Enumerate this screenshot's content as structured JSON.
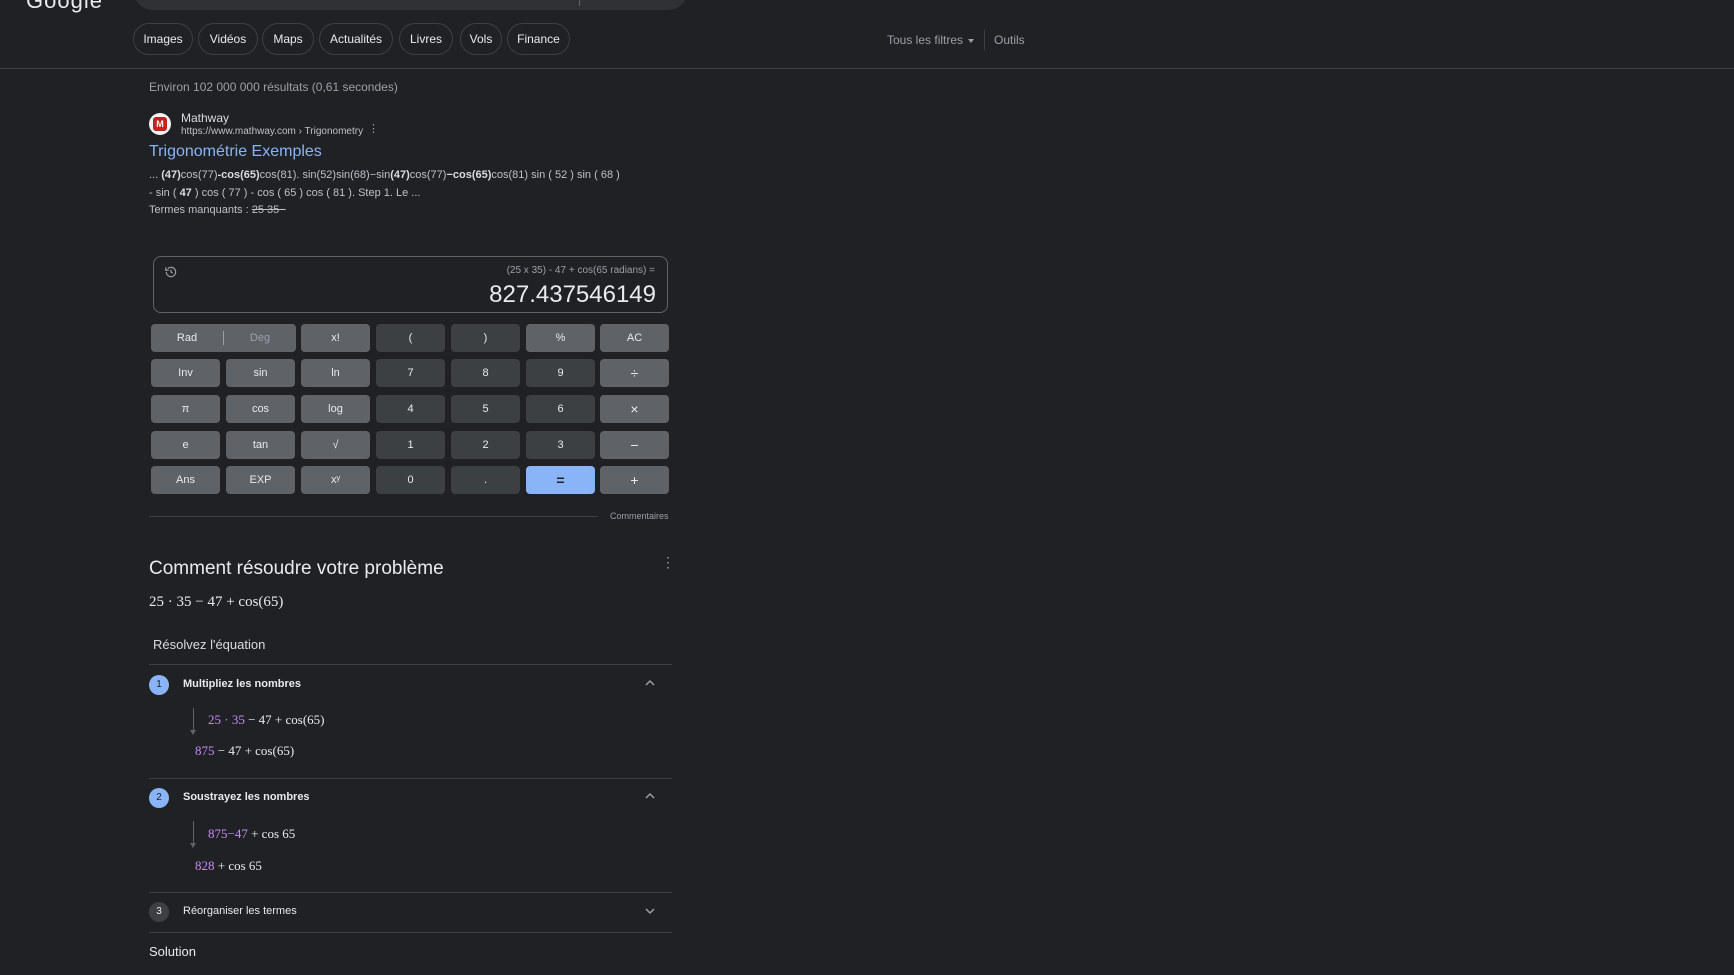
{
  "header": {
    "logo": "Google",
    "tabs": [
      "Images",
      "Vidéos",
      "Maps",
      "Actualités",
      "Livres",
      "Vols",
      "Finance"
    ],
    "filters_label": "Tous les filtres",
    "tools_label": "Outils"
  },
  "result_stats": "Environ 102 000 000 résultats (0,61 secondes)",
  "result": {
    "favicon_letter": "M",
    "site_name": "Mathway",
    "url": "https://www.mathway.com › Trigonometry",
    "title": "Trigonométrie Exemples",
    "snippet_1": [
      {
        "t": "... ",
        "b": false
      },
      {
        "t": "(47)",
        "b": true
      },
      {
        "t": "cos(77)",
        "b": false
      },
      {
        "t": "-cos(65)",
        "b": true
      },
      {
        "t": "cos(81). sin(52)sin(68)−sin",
        "b": false
      },
      {
        "t": "(47)",
        "b": true
      },
      {
        "t": "cos(77)",
        "b": false
      },
      {
        "t": "−cos(65)",
        "b": true
      },
      {
        "t": "cos(81) sin ( 52 ) sin ( 68 )",
        "b": false
      }
    ],
    "snippet_2": [
      {
        "t": "- sin ( ",
        "b": false
      },
      {
        "t": "47",
        "b": true
      },
      {
        "t": " ) cos ( 77 ) - cos ( 65 ) cos ( 81 ). Step 1. Le ...",
        "b": false
      }
    ],
    "missing_label": "Termes manquants : ",
    "missing_terms": "25 35−"
  },
  "calculator": {
    "expression": "(25 x 35) - 47 + cos(65 radians) =",
    "result": "827.437546149",
    "rad_label": "Rad",
    "deg_label": "Deg",
    "feedback_label": "Commentaires",
    "keys": [
      {
        "label": "x!",
        "kind": "func"
      },
      {
        "label": "(",
        "kind": "num"
      },
      {
        "label": ")",
        "kind": "num"
      },
      {
        "label": "%",
        "kind": "func"
      },
      {
        "label": "AC",
        "kind": "func"
      },
      {
        "label": "Inv",
        "kind": "func"
      },
      {
        "label": "sin",
        "kind": "func"
      },
      {
        "label": "ln",
        "kind": "func"
      },
      {
        "label": "7",
        "kind": "num"
      },
      {
        "label": "8",
        "kind": "num"
      },
      {
        "label": "9",
        "kind": "num"
      },
      {
        "label": "÷",
        "kind": "op"
      },
      {
        "label": "π",
        "kind": "func"
      },
      {
        "label": "cos",
        "kind": "func"
      },
      {
        "label": "log",
        "kind": "func"
      },
      {
        "label": "4",
        "kind": "num"
      },
      {
        "label": "5",
        "kind": "num"
      },
      {
        "label": "6",
        "kind": "num"
      },
      {
        "label": "×",
        "kind": "op"
      },
      {
        "label": "e",
        "kind": "func"
      },
      {
        "label": "tan",
        "kind": "func"
      },
      {
        "label": "√",
        "kind": "func"
      },
      {
        "label": "1",
        "kind": "num"
      },
      {
        "label": "2",
        "kind": "num"
      },
      {
        "label": "3",
        "kind": "num"
      },
      {
        "label": "−",
        "kind": "op"
      },
      {
        "label": "Ans",
        "kind": "func"
      },
      {
        "label": "EXP",
        "kind": "func"
      },
      {
        "label": "xʸ",
        "kind": "func"
      },
      {
        "label": "0",
        "kind": "num"
      },
      {
        "label": ".",
        "kind": "num"
      },
      {
        "label": "=",
        "kind": "eq"
      },
      {
        "label": "+",
        "kind": "op"
      }
    ]
  },
  "solver": {
    "title": "Comment résoudre votre problème",
    "expression": "25 · 35 − 47 + cos(65)",
    "subtitle": "Résolvez l'équation",
    "solution_label": "Solution",
    "steps": [
      {
        "number": "1",
        "title": "Multipliez les nombres",
        "expanded": true,
        "from": [
          {
            "t": "25 · 35",
            "hl": true
          },
          {
            "t": " − 47 + cos(65)",
            "hl": false
          }
        ],
        "to": [
          {
            "t": "875",
            "hl": true
          },
          {
            "t": " − 47 + cos(65)",
            "hl": false
          }
        ]
      },
      {
        "number": "2",
        "title": "Soustrayez les nombres",
        "expanded": true,
        "from": [
          {
            "t": "875−47",
            "hl": true
          },
          {
            "t": " + cos 65",
            "hl": false
          }
        ],
        "to": [
          {
            "t": "828",
            "hl": true
          },
          {
            "t": " + cos 65",
            "hl": false
          }
        ]
      },
      {
        "number": "3",
        "title": "Réorganiser les termes",
        "expanded": false
      }
    ]
  },
  "colors": {
    "background": "#202124",
    "link": "#8ab4f8",
    "highlight": "#c58af9",
    "equals_key": "#8ab4f8"
  }
}
